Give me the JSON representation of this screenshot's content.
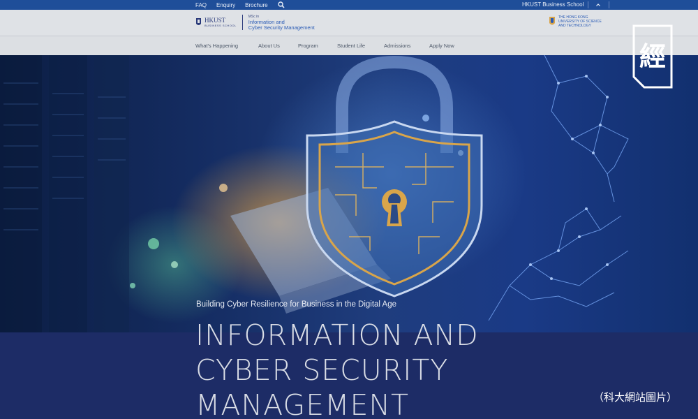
{
  "utility": {
    "links": [
      "FAQ",
      "Enquiry",
      "Brochure"
    ],
    "search_icon": "search-icon",
    "school": "HKUST Business School"
  },
  "header": {
    "logo_text": "HKUST",
    "logo_sub": "BUSINESS SCHOOL",
    "program_prefix": "MSc in",
    "program_line1": "Information and",
    "program_line2": "Cyber Security Management",
    "uni_line1": "THE HONG KONG",
    "uni_line2": "UNIVERSITY OF SCIENCE",
    "uni_line3": "AND TECHNOLOGY"
  },
  "nav": {
    "items": [
      "What's Happening",
      "About Us",
      "Program",
      "Student Life",
      "Admissions",
      "Apply Now"
    ]
  },
  "hero": {
    "tagline": "Building Cyber Resilience for Business in the Digital Age",
    "title_lines": [
      "INFORMATION AND",
      "CYBER SECURITY",
      "MANAGEMENT"
    ]
  },
  "overlay": {
    "badge_char": "經",
    "caption": "（科大網站圖片）"
  },
  "colors": {
    "utility_bar": "#1f4e99",
    "title_bg": "#1d2c66",
    "shield_gold": "#d9a54a"
  }
}
